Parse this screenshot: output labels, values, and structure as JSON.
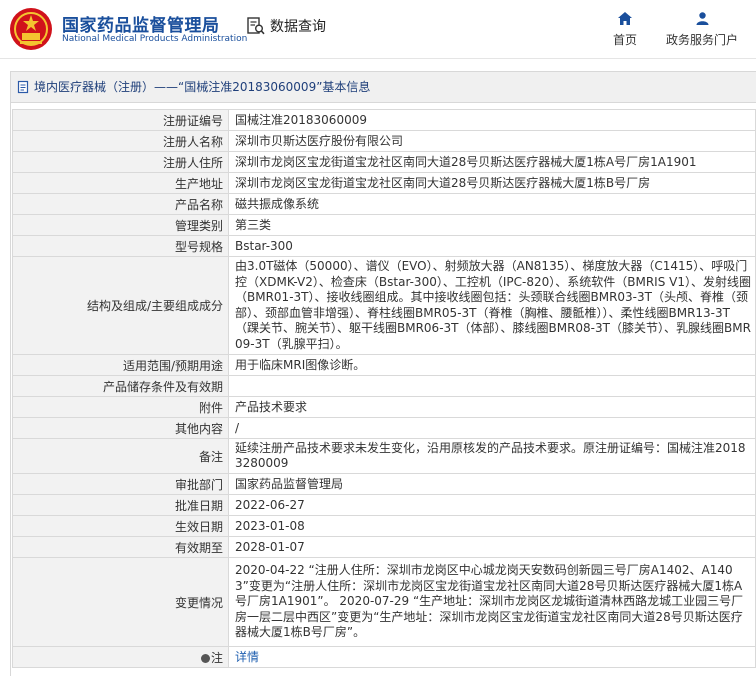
{
  "header": {
    "brand_cn": "国家药品监督管理局",
    "brand_en": "National Medical Products Administration",
    "query_label": "数据查询",
    "nav": [
      {
        "label": "首页",
        "icon": "home-icon"
      },
      {
        "label": "政务服务门户",
        "icon": "user-icon"
      }
    ],
    "brand_color": "#1a4f9c",
    "logo_color": "#d0121b"
  },
  "panel": {
    "title": "境内医疗器械（注册）——“国械注准20183060009”基本信息"
  },
  "rows": [
    {
      "label": "注册证编号",
      "value": "国械注准20183060009"
    },
    {
      "label": "注册人名称",
      "value": "深圳市贝斯达医疗股份有限公司"
    },
    {
      "label": "注册人住所",
      "value": "深圳市龙岗区宝龙街道宝龙社区南同大道28号贝斯达医疗器械大厦1栋A号厂房1A1901"
    },
    {
      "label": "生产地址",
      "value": "深圳市龙岗区宝龙街道宝龙社区南同大道28号贝斯达医疗器械大厦1栋B号厂房"
    },
    {
      "label": "产品名称",
      "value": "磁共振成像系统"
    },
    {
      "label": "管理类别",
      "value": "第三类"
    },
    {
      "label": "型号规格",
      "value": "Bstar-300"
    },
    {
      "label": "结构及组成/主要组成成分",
      "value": "由3.0T磁体（50000）、谱仪（EVO）、射频放大器（AN8135）、梯度放大器（C1415）、呼吸门控（XDMK-V2）、检查床（Bstar-300）、工控机（IPC-820）、系统软件（BMRIS V1）、发射线圈（BMR01-3T）、接收线圈组成。其中接收线圈包括：头颈联合线圈BMR03-3T（头颅、脊椎（颈部）、颈部血管非增强）、脊柱线圈BMR05-3T（脊椎（胸椎、腰骶椎））、柔性线圈BMR13-3T（踝关节、腕关节）、躯干线圈BMR06-3T（体部）、膝线圈BMR08-3T（膝关节）、乳腺线圈BMR09-3T（乳腺平扫）。"
    },
    {
      "label": "适用范围/预期用途",
      "value": "用于临床MRI图像诊断。"
    },
    {
      "label": "产品储存条件及有效期",
      "value": ""
    },
    {
      "label": "附件",
      "value": "产品技术要求"
    },
    {
      "label": "其他内容",
      "value": "/"
    },
    {
      "label": "备注",
      "value": "延续注册产品技术要求未发生变化，沿用原核发的产品技术要求。原注册证编号：国械注准20183280009"
    },
    {
      "label": "审批部门",
      "value": "国家药品监督管理局"
    },
    {
      "label": "批准日期",
      "value": "2022-06-27"
    },
    {
      "label": "生效日期",
      "value": "2023-01-08"
    },
    {
      "label": "有效期至",
      "value": "2028-01-07"
    },
    {
      "label": "变更情况",
      "value": "2020-04-22 “注册人住所：深圳市龙岗区中心城龙岗天安数码创新园三号厂房A1402、A1403”变更为“注册人住所：深圳市龙岗区宝龙街道宝龙社区南同大道28号贝斯达医疗器械大厦1栋A号厂房1A1901”。 2020-07-29 “生产地址：深圳市龙岗区龙城街道清林西路龙城工业园三号厂房一层二层中西区”变更为“生产地址：深圳市龙岗区宝龙街道宝龙社区南同大道28号贝斯达医疗器械大厦1栋B号厂房”。"
    },
    {
      "label": "注",
      "value": "详情"
    }
  ]
}
